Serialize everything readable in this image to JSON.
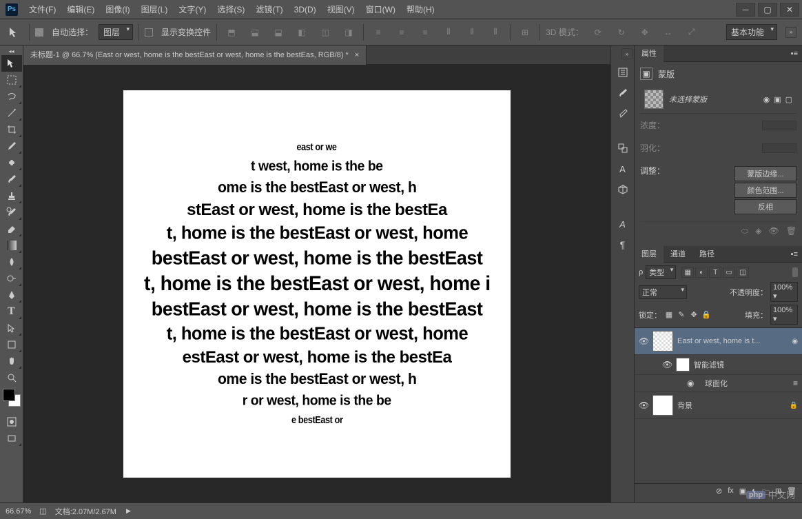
{
  "app_icon": "Ps",
  "menus": [
    "文件(F)",
    "编辑(E)",
    "图像(I)",
    "图层(L)",
    "文字(Y)",
    "选择(S)",
    "滤镜(T)",
    "3D(D)",
    "视图(V)",
    "窗口(W)",
    "帮助(H)"
  ],
  "options": {
    "auto_select": "自动选择：",
    "auto_select_target": "图层",
    "show_transform": "显示变换控件",
    "mode_3d": "3D 模式：",
    "workspace": "基本功能"
  },
  "document": {
    "tab_title": "未标题-1 @ 66.7% (East or west, home is the bestEast or west, home is the bestEas, RGB/8) *",
    "sphere_lines": [
      {
        "text": "east or we",
        "size": 18,
        "sx": 0.7,
        "sy": 0.8
      },
      {
        "text": "t west, home is the be",
        "size": 22,
        "sx": 0.88,
        "sy": 0.92
      },
      {
        "text": "ome is the bestEast or west, h",
        "size": 22,
        "sx": 0.96,
        "sy": 1.0
      },
      {
        "text": "stEast or west, home is the bestEa",
        "size": 24,
        "sx": 1.0,
        "sy": 1.02
      },
      {
        "text": "t, home is the bestEast or west, home",
        "size": 25,
        "sx": 1.02,
        "sy": 1.05
      },
      {
        "text": "bestEast or west, home is the bestEast",
        "size": 26,
        "sx": 1.04,
        "sy": 1.08
      },
      {
        "text": "t, home is the bestEast or west, home i",
        "size": 27,
        "sx": 1.05,
        "sy": 1.1
      },
      {
        "text": "bestEast or west, home is the bestEast",
        "size": 26,
        "sx": 1.04,
        "sy": 1.08
      },
      {
        "text": "t, home is the bestEast or west, home",
        "size": 25,
        "sx": 1.02,
        "sy": 1.05
      },
      {
        "text": "estEast or west, home is the bestEa",
        "size": 24,
        "sx": 1.0,
        "sy": 1.02
      },
      {
        "text": "ome is the bestEast or west, h",
        "size": 22,
        "sx": 0.96,
        "sy": 1.0
      },
      {
        "text": "r or west, home is the be",
        "size": 22,
        "sx": 0.88,
        "sy": 0.92
      },
      {
        "text": "e bestEast or",
        "size": 18,
        "sx": 0.7,
        "sy": 0.8
      }
    ]
  },
  "properties": {
    "tab": "属性",
    "header": "蒙版",
    "no_mask": "未选择蒙版",
    "density": "浓度：",
    "feather": "羽化：",
    "adjust": "调整：",
    "btn_mask_edge": "蒙版边缘...",
    "btn_color_range": "颜色范围...",
    "btn_invert": "反相"
  },
  "layers": {
    "tabs": [
      "图层",
      "通道",
      "路径"
    ],
    "kind": "类型",
    "blend": "正常",
    "opacity_label": "不透明度：",
    "opacity": "100%",
    "lock_label": "锁定：",
    "fill_label": "填充：",
    "fill": "100%",
    "items": [
      {
        "name": "East or west, home is t...",
        "selected": true,
        "thumb": "text"
      },
      {
        "name": "智能滤镜",
        "sub": 1
      },
      {
        "name": "球面化",
        "sub": 2
      },
      {
        "name": "背景",
        "locked": true
      }
    ]
  },
  "status": {
    "zoom": "66.67%",
    "doc_info": "文档:2.07M/2.67M"
  },
  "watermark": {
    "php": "php",
    "text": "中文网"
  }
}
